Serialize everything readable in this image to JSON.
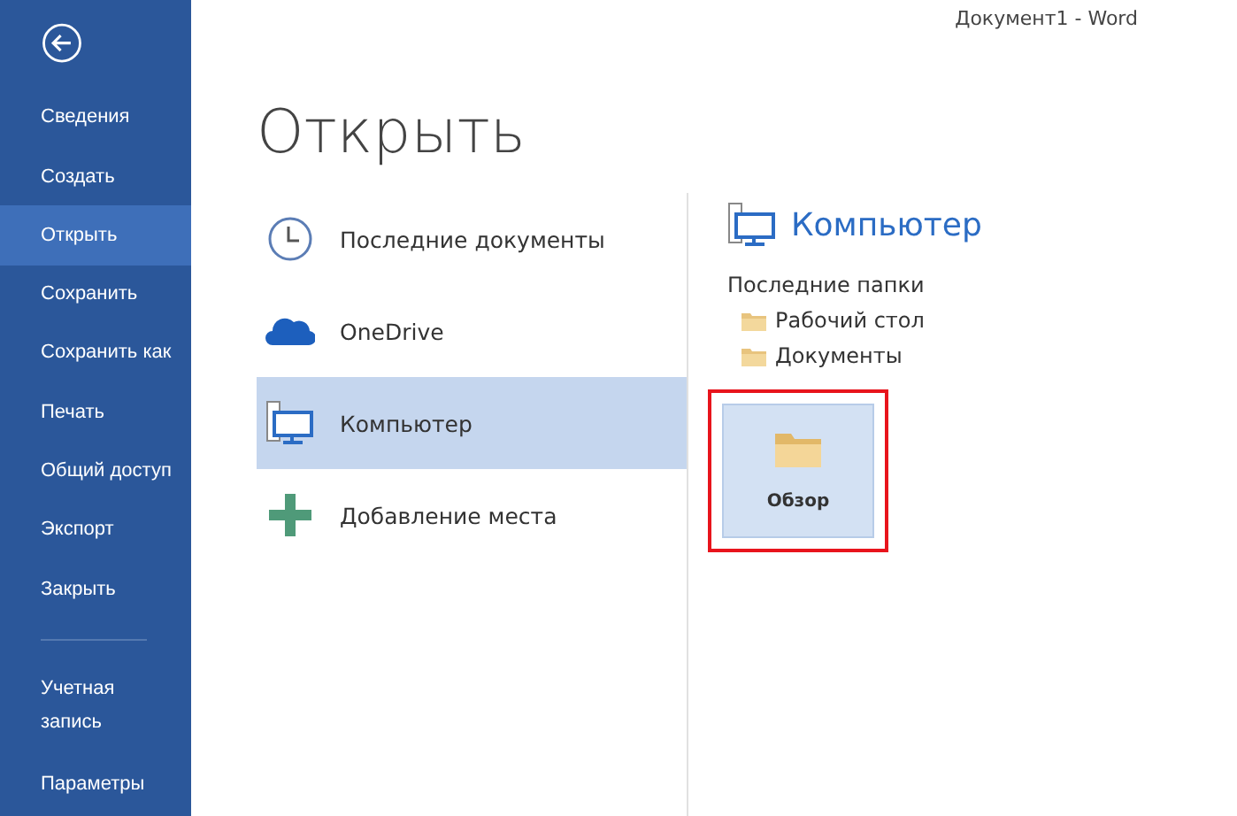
{
  "window": {
    "title": "Документ1 - Word"
  },
  "sidebar": {
    "items": [
      {
        "label": "Сведения",
        "selected": false
      },
      {
        "label": "Создать",
        "selected": false
      },
      {
        "label": "Открыть",
        "selected": true
      },
      {
        "label": "Сохранить",
        "selected": false
      },
      {
        "label": "Сохранить как",
        "selected": false
      },
      {
        "label": "Печать",
        "selected": false
      },
      {
        "label": "Общий доступ",
        "selected": false
      },
      {
        "label": "Экспорт",
        "selected": false
      },
      {
        "label": "Закрыть",
        "selected": false
      }
    ],
    "footer_items": [
      {
        "label": "Учетная запись",
        "selected": false
      },
      {
        "label": "Параметры",
        "selected": false
      }
    ]
  },
  "page": {
    "title": "Открыть"
  },
  "places": [
    {
      "kind": "recent",
      "label": "Последние документы",
      "selected": false
    },
    {
      "kind": "cloud",
      "label": "OneDrive",
      "selected": false
    },
    {
      "kind": "computer",
      "label": "Компьютер",
      "selected": true
    },
    {
      "kind": "add",
      "label": "Добавление места",
      "selected": false
    }
  ],
  "detail": {
    "heading": "Компьютер",
    "recent_heading": "Последние папки",
    "folders": [
      "Рабочий стол",
      "Документы"
    ],
    "browse": {
      "label": "Обзор",
      "highlighted": true
    }
  }
}
